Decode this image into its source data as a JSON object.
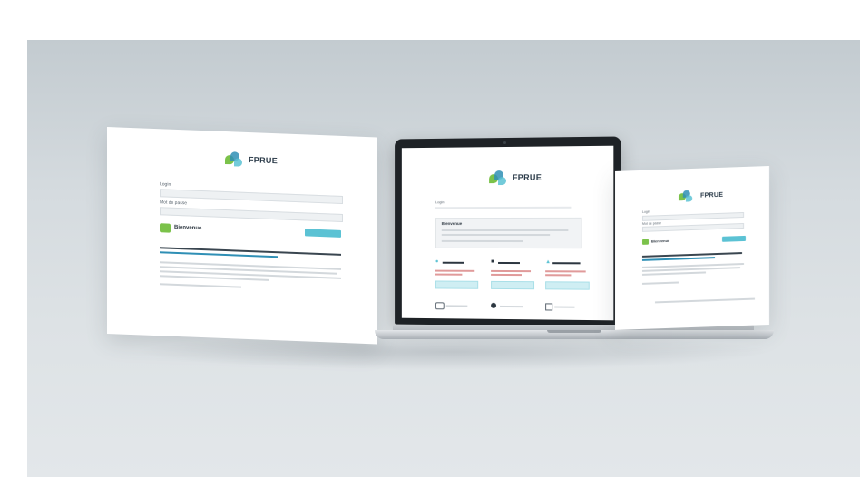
{
  "left_panel": {
    "brand": "FPRUE",
    "login_label": "Login",
    "password_label": "Mot de passe",
    "section_title": "Bienvenue",
    "button_label": "",
    "notice_title": "",
    "notice_link": "",
    "footer_link": ""
  },
  "laptop": {
    "brand": "FPRUE",
    "login_label": "Login",
    "password_label": "Mot de passe",
    "welcome_title": "Bienvenue",
    "cards": [
      {
        "title": "",
        "icon": "user-icon"
      },
      {
        "title": "",
        "icon": "lock-icon"
      },
      {
        "title": "",
        "icon": "key-icon"
      }
    ],
    "footer_items": [
      "",
      "",
      ""
    ]
  },
  "right_panel": {
    "brand": "FPRUE",
    "login_label": "Login",
    "password_label": "Mot de passe",
    "section_title": "Bienvenue",
    "button_label": ""
  },
  "colors": {
    "accent": "#5bc2d4",
    "brand_green": "#7bc24a",
    "brand_blue": "#2f8fb5",
    "backdrop": "#d5dbdf"
  }
}
